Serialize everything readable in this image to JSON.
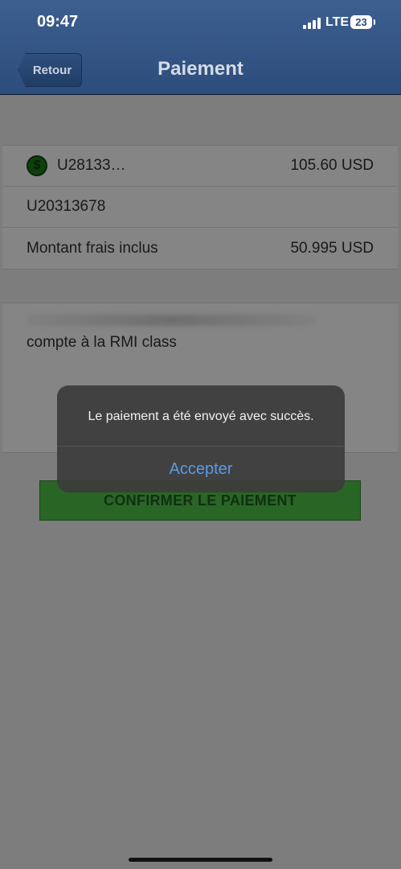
{
  "status_bar": {
    "time": "09:47",
    "network": "LTE",
    "battery": "23"
  },
  "nav": {
    "back_label": "Retour",
    "title": "Paiement"
  },
  "payment": {
    "rows": [
      {
        "label": "U28133…",
        "value": "105.60 USD",
        "icon": "dollar-icon"
      },
      {
        "label": "U20313678",
        "value": ""
      },
      {
        "label": "Montant frais inclus",
        "value": "50.995 USD"
      }
    ]
  },
  "note": {
    "text": "compte à la RMI class"
  },
  "confirm_button": {
    "label": "CONFIRMER LE PAIEMENT"
  },
  "alert": {
    "message": "Le paiement a été envoyé avec succès.",
    "button": "Accepter"
  }
}
